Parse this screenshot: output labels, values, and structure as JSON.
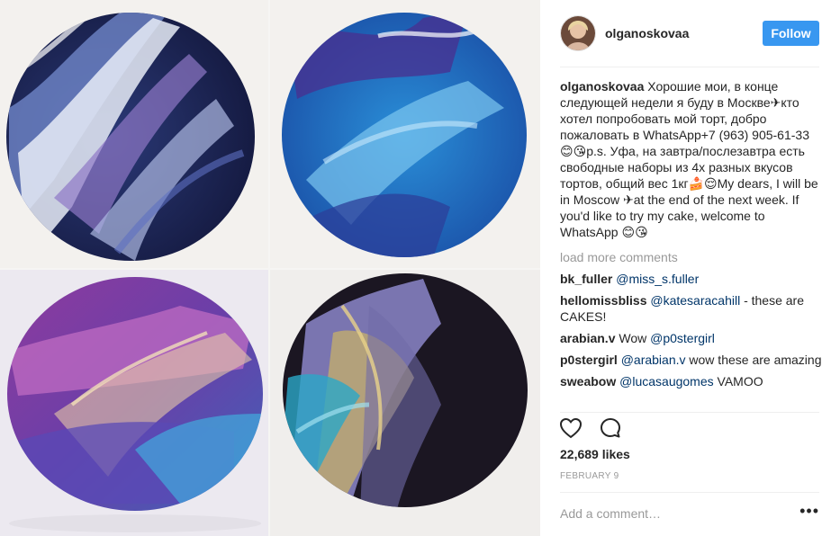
{
  "post": {
    "username": "olganoskovaa",
    "follow_label": "Follow",
    "caption": "Хорошие мои, в конце следующей недели я буду в Москве✈кто хотел попробовать мой торт, добро пожаловать в WhatsApp+7 (963) 905-61-33 😊😘p.s. Уфа, на завтра/послезавтра есть свободные наборы из 4х разных вкусов тортов, общий вес 1кг🍰😌My dears, I will be in Moscow ✈at the end of the next week. If you'd like to try my cake, welcome to WhatsApp 😊😘",
    "load_more": "load more comments",
    "likes": "22,689 likes",
    "date": "FEBRUARY 9",
    "comment_placeholder": "Add a comment…",
    "more_options": "•••"
  },
  "comments": [
    {
      "user": "bk_fuller",
      "mention": "@miss_s.fuller",
      "text": ""
    },
    {
      "user": "hellomissbliss",
      "mention": "@katesaracahill",
      "text": " - these are CAKES!"
    },
    {
      "user": "arabian.v",
      "text_before": "Wow ",
      "mention": "@p0stergirl",
      "text": ""
    },
    {
      "user": "p0stergirl",
      "mention": "@arabian.v",
      "text": " wow these are amazing"
    },
    {
      "user": "sweabow",
      "mention": "@lucasaugomes",
      "text": " VAMOO"
    }
  ],
  "icons": {
    "like": "heart-outline-icon",
    "comment": "speech-bubble-icon",
    "avatar": "profile-photo"
  },
  "colors": {
    "accent": "#3897f0",
    "mention": "#003569",
    "muted": "#999999"
  }
}
